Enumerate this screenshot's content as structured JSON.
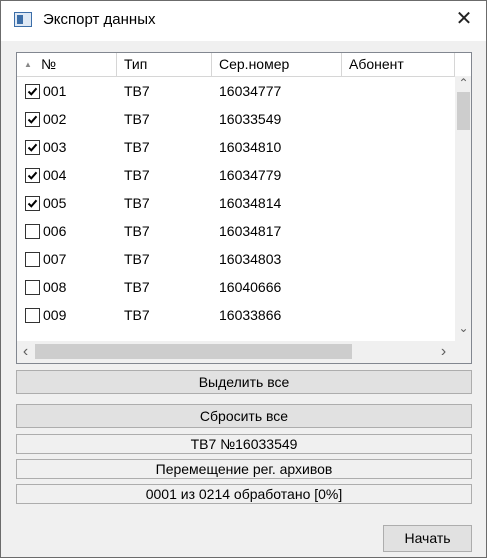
{
  "window": {
    "title": "Экспорт данных",
    "close_glyph": "✕"
  },
  "grid": {
    "columns": [
      "№",
      "Тип",
      "Сер.номер",
      "Абонент"
    ],
    "sort_glyph": "▲",
    "rows": [
      {
        "checked": true,
        "num": "001",
        "type": "ТВ7",
        "serial": "16034777",
        "subscriber": ""
      },
      {
        "checked": true,
        "num": "002",
        "type": "ТВ7",
        "serial": "16033549",
        "subscriber": ""
      },
      {
        "checked": true,
        "num": "003",
        "type": "ТВ7",
        "serial": "16034810",
        "subscriber": ""
      },
      {
        "checked": true,
        "num": "004",
        "type": "ТВ7",
        "serial": "16034779",
        "subscriber": ""
      },
      {
        "checked": true,
        "num": "005",
        "type": "ТВ7",
        "serial": "16034814",
        "subscriber": ""
      },
      {
        "checked": false,
        "num": "006",
        "type": "ТВ7",
        "serial": "16034817",
        "subscriber": ""
      },
      {
        "checked": false,
        "num": "007",
        "type": "ТВ7",
        "serial": "16034803",
        "subscriber": ""
      },
      {
        "checked": false,
        "num": "008",
        "type": "ТВ7",
        "serial": "16040666",
        "subscriber": ""
      },
      {
        "checked": false,
        "num": "009",
        "type": "ТВ7",
        "serial": "16033866",
        "subscriber": ""
      }
    ],
    "scroll_glyphs": {
      "up": "⌃",
      "down": "⌄",
      "left": "‹",
      "right": "›"
    }
  },
  "actions": {
    "select_all": "Выделить все",
    "reset_all": "Сбросить все",
    "start": "Начать"
  },
  "status": {
    "device": "ТВ7 №16033549",
    "operation": "Перемещение рег. архивов",
    "progress": "0001 из 0214 обработано [0%]"
  },
  "colors": {
    "accent": "#3c6ea8",
    "border": "#828790"
  }
}
